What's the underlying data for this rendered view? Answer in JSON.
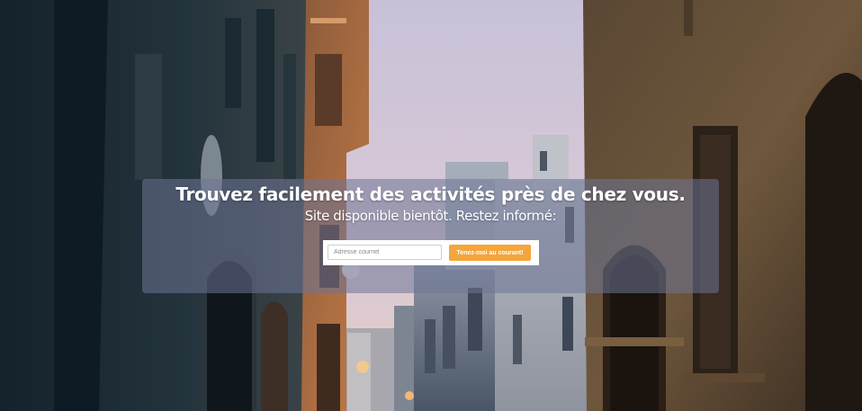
{
  "hero": {
    "headline": "Trouvez facilement des activités près de chez vous.",
    "subline": "Site disponible bientôt. Restez informé:"
  },
  "signup": {
    "email_placeholder": "Adresse courriel",
    "submit_label": "Tenez-moi au courant!"
  },
  "background": {
    "scene": "street-between-old-buildings-photo"
  },
  "colors": {
    "accent": "#f5a53a",
    "panel_overlay": "#6e7496",
    "text": "#ffffff"
  }
}
